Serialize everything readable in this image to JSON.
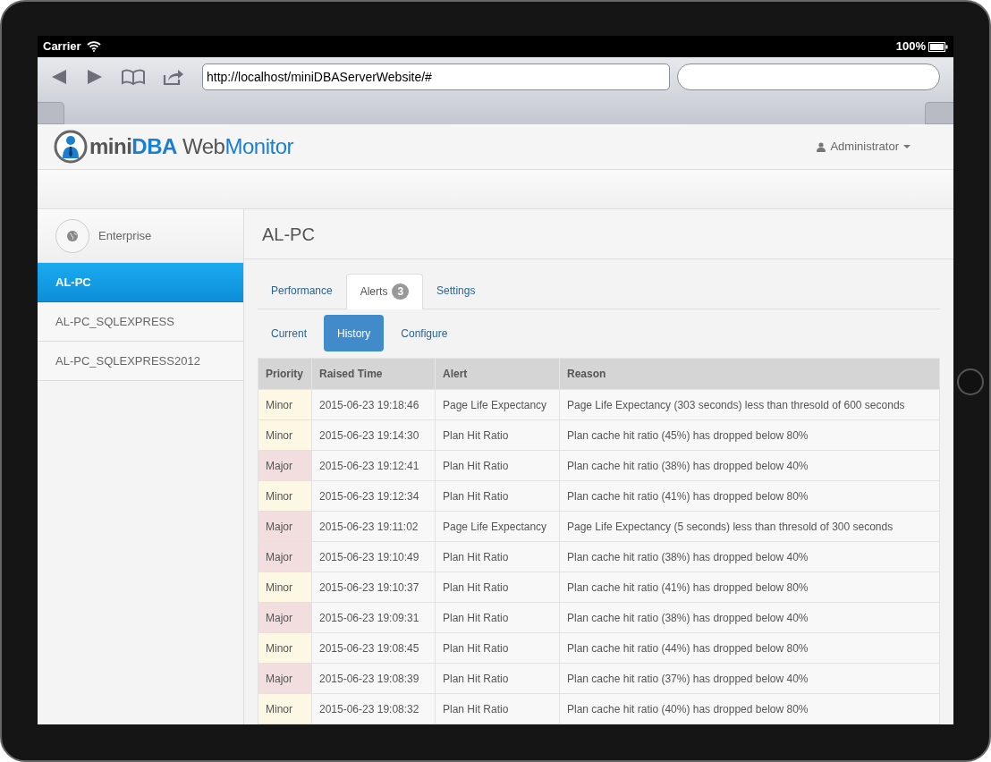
{
  "status_bar": {
    "carrier": "Carrier",
    "battery": "100%"
  },
  "browser": {
    "url": "http://localhost/miniDBAServerWebsite/#"
  },
  "header": {
    "logo": {
      "part1": "mini",
      "part2": "DBA",
      "part3": " Web",
      "part4": "Monitor"
    },
    "user": "Administrator"
  },
  "sidebar": {
    "enterprise": "Enterprise",
    "items": [
      {
        "label": "AL-PC",
        "selected": true
      },
      {
        "label": "AL-PC_SQLEXPRESS",
        "selected": false
      },
      {
        "label": "AL-PC_SQLEXPRESS2012",
        "selected": false
      }
    ]
  },
  "title": "AL-PC",
  "tabs": [
    {
      "label": "Performance",
      "selected": false
    },
    {
      "label": "Alerts",
      "badge": "3",
      "selected": true
    },
    {
      "label": "Settings",
      "selected": false
    }
  ],
  "subtabs": [
    {
      "label": "Current",
      "selected": false
    },
    {
      "label": "History",
      "selected": true
    },
    {
      "label": "Configure",
      "selected": false
    }
  ],
  "table": {
    "columns": [
      "Priority",
      "Raised Time",
      "Alert",
      "Reason"
    ],
    "rows": [
      {
        "priority": "Minor",
        "color": "#fcf8e3",
        "time": "2015-06-23 19:18:46",
        "alert": "Page Life Expectancy",
        "reason": "Page Life Expectancy (303 seconds) less than thresold of 600 seconds"
      },
      {
        "priority": "Minor",
        "color": "#fcf8e3",
        "time": "2015-06-23 19:14:30",
        "alert": "Plan Hit Ratio",
        "reason": "Plan cache hit ratio (45%) has dropped below 80%"
      },
      {
        "priority": "Major",
        "color": "#f2dede",
        "time": "2015-06-23 19:12:41",
        "alert": "Plan Hit Ratio",
        "reason": "Plan cache hit ratio (38%) has dropped below 40%"
      },
      {
        "priority": "Minor",
        "color": "#fcf8e3",
        "time": "2015-06-23 19:12:34",
        "alert": "Plan Hit Ratio",
        "reason": "Plan cache hit ratio (41%) has dropped below 80%"
      },
      {
        "priority": "Major",
        "color": "#f2dede",
        "time": "2015-06-23 19:11:02",
        "alert": "Page Life Expectancy",
        "reason": "Page Life Expectancy (5 seconds) less than thresold of 300 seconds"
      },
      {
        "priority": "Major",
        "color": "#f2dede",
        "time": "2015-06-23 19:10:49",
        "alert": "Plan Hit Ratio",
        "reason": "Plan cache hit ratio (38%) has dropped below 40%"
      },
      {
        "priority": "Minor",
        "color": "#fcf8e3",
        "time": "2015-06-23 19:10:37",
        "alert": "Plan Hit Ratio",
        "reason": "Plan cache hit ratio (41%) has dropped below 80%"
      },
      {
        "priority": "Major",
        "color": "#f2dede",
        "time": "2015-06-23 19:09:31",
        "alert": "Plan Hit Ratio",
        "reason": "Plan cache hit ratio (38%) has dropped below 40%"
      },
      {
        "priority": "Minor",
        "color": "#fcf8e3",
        "time": "2015-06-23 19:08:45",
        "alert": "Plan Hit Ratio",
        "reason": "Plan cache hit ratio (44%) has dropped below 80%"
      },
      {
        "priority": "Major",
        "color": "#f2dede",
        "time": "2015-06-23 19:08:39",
        "alert": "Plan Hit Ratio",
        "reason": "Plan cache hit ratio (37%) has dropped below 40%"
      },
      {
        "priority": "Minor",
        "color": "#fcf8e3",
        "time": "2015-06-23 19:08:32",
        "alert": "Plan Hit Ratio",
        "reason": "Plan cache hit ratio (40%) has dropped below 80%"
      }
    ]
  }
}
